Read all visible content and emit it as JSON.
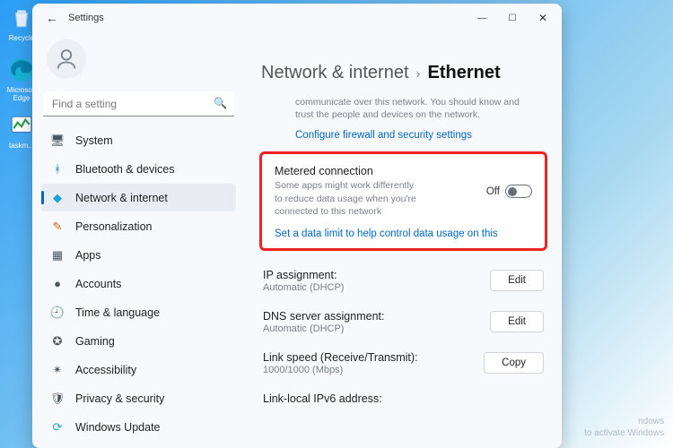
{
  "desktop": {
    "icons": [
      {
        "label": "Recycle"
      },
      {
        "label": "Microsoft Edge"
      },
      {
        "label": "taskm..."
      }
    ]
  },
  "window": {
    "title": "Settings",
    "controls": {
      "min": "—",
      "max": "☐",
      "close": "✕"
    }
  },
  "search": {
    "placeholder": "Find a setting"
  },
  "sidebar": {
    "items": [
      {
        "label": "System",
        "icon": "🖥",
        "color": "#4a5560"
      },
      {
        "label": "Bluetooth & devices",
        "icon": "ᚼ",
        "color": "#0067c0"
      },
      {
        "label": "Network & internet",
        "icon": "◆",
        "color": "#16a3d8",
        "active": true
      },
      {
        "label": "Personalization",
        "icon": "✎",
        "color": "#c76a1e"
      },
      {
        "label": "Apps",
        "icon": "▦",
        "color": "#4a5560"
      },
      {
        "label": "Accounts",
        "icon": "●",
        "color": "#4a5560"
      },
      {
        "label": "Time & language",
        "icon": "🕘",
        "color": "#4a5560"
      },
      {
        "label": "Gaming",
        "icon": "✪",
        "color": "#4a5560"
      },
      {
        "label": "Accessibility",
        "icon": "✴",
        "color": "#4a5560"
      },
      {
        "label": "Privacy & security",
        "icon": "🛡",
        "color": "#4a5560"
      },
      {
        "label": "Windows Update",
        "icon": "⟳",
        "color": "#2aa3d6"
      }
    ]
  },
  "breadcrumb": {
    "parent": "Network & internet",
    "sep": "›",
    "current": "Ethernet"
  },
  "truncated": {
    "line": "communicate over this network. You should know and trust the people and devices on the network.",
    "link": "Configure firewall and security settings"
  },
  "metered": {
    "title": "Metered connection",
    "desc": "Some apps might work differently to reduce data usage when you're connected to this network",
    "state_label": "Off",
    "link": "Set a data limit to help control data usage on this"
  },
  "rows": [
    {
      "k": "IP assignment:",
      "v": "Automatic (DHCP)",
      "btn": "Edit"
    },
    {
      "k": "DNS server assignment:",
      "v": "Automatic (DHCP)",
      "btn": "Edit"
    },
    {
      "k": "Link speed (Receive/Transmit):",
      "v": "1000/1000 (Mbps)",
      "btn": "Copy"
    },
    {
      "k": "Link-local IPv6 address:",
      "v": "",
      "btn": ""
    }
  ],
  "watermark": {
    "l1": "ndows",
    "l2": "to activate Windows"
  }
}
